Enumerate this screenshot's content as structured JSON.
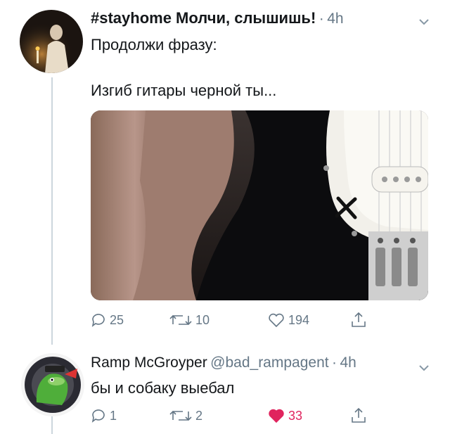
{
  "tweet1": {
    "author_name": "#stayhome Молчи, слышишь!",
    "dot": "·",
    "time": "4h",
    "text_line1": "Продолжи фразу:",
    "text_line2": "Изгиб гитары черной ты...",
    "replies": "25",
    "retweets": "10",
    "likes": "194"
  },
  "tweet2": {
    "author_name": "Ramp McGroyper",
    "handle": "@bad_rampagent",
    "dot": "·",
    "time": "4h",
    "text": "бы и собаку выебал",
    "replies": "1",
    "retweets": "2",
    "likes": "33"
  },
  "colors": {
    "muted": "#657786",
    "like_active": "#e0245e",
    "thread_line": "#ccd6dd"
  },
  "icons": [
    "reply-icon",
    "retweet-icon",
    "like-icon",
    "share-icon",
    "chevron-down-icon"
  ]
}
